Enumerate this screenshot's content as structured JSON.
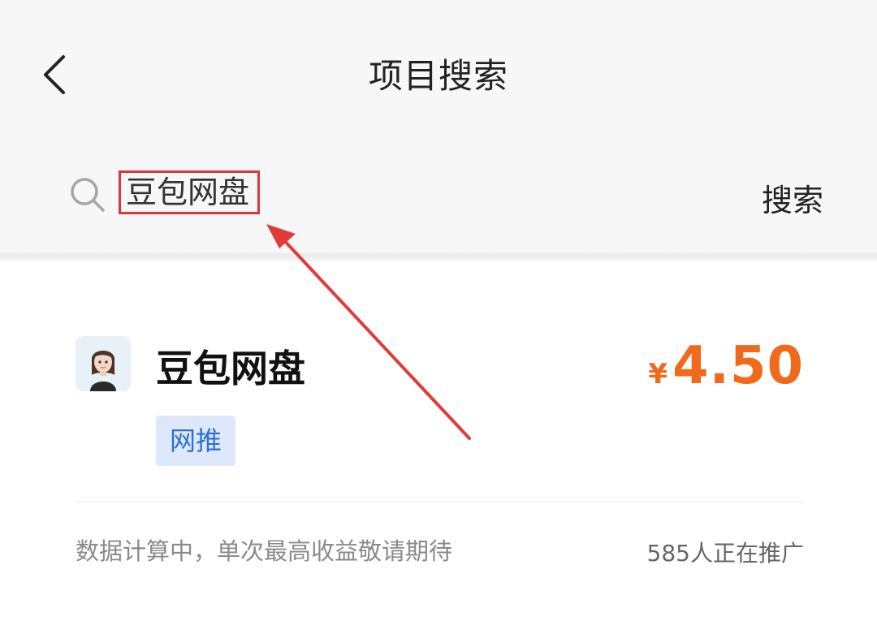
{
  "header": {
    "back_icon": "chevron-left-icon",
    "title": "项目搜索"
  },
  "search": {
    "icon": "search-icon",
    "value": "豆包网盘",
    "button_label": "搜索",
    "highlight_color": "#d9363e"
  },
  "project": {
    "avatar_icon": "avatar-woman",
    "name": "豆包网盘",
    "price_symbol": "¥",
    "price": "4.50",
    "tag": "网推",
    "note": "数据计算中，单次最高收益敬请期待",
    "promoters": "585人正在推广"
  },
  "colors": {
    "price": "#f06a1d",
    "tag_text": "#2f6fd6",
    "tag_bg": "#dde9fb",
    "annotation_red": "#e23a3a"
  }
}
